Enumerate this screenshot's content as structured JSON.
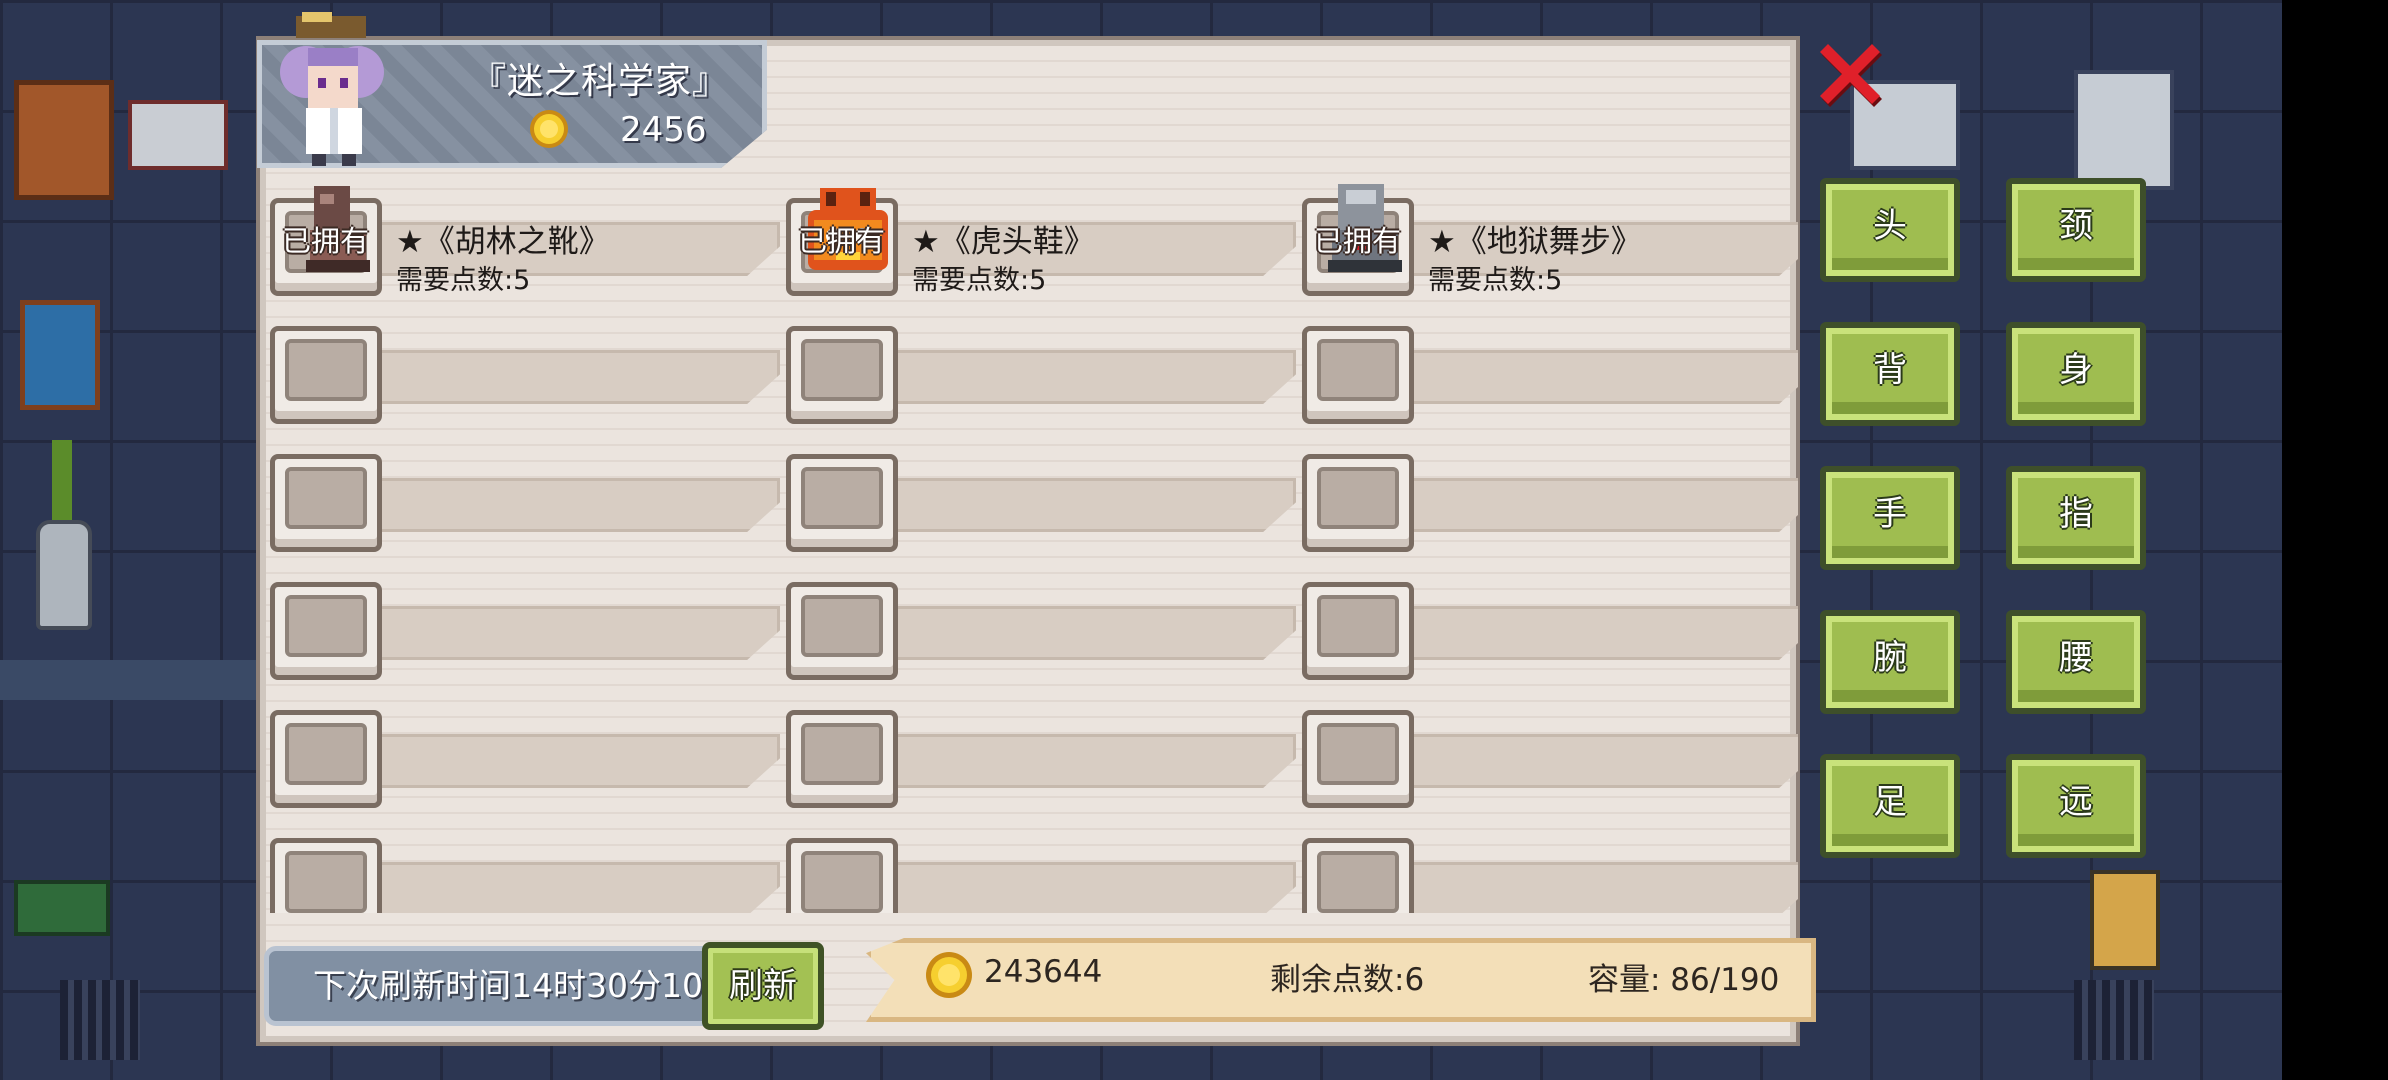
{
  "merchant": {
    "name": "『迷之科学家』",
    "gold": "2456"
  },
  "items": [
    [
      {
        "owned_label": "已拥有",
        "name": "★《胡林之靴》",
        "cost": "需要点数:5",
        "icon": "hurin-boots-icon"
      },
      {
        "owned_label": "已拥有",
        "name": "★《虎头鞋》",
        "cost": "需要点数:5",
        "icon": "tiger-shoes-icon"
      },
      {
        "owned_label": "已拥有",
        "name": "★《地狱舞步》",
        "cost": "需要点数:5",
        "icon": "hell-dance-icon"
      }
    ],
    [
      {
        "empty": true
      },
      {
        "empty": true
      },
      {
        "empty": true
      }
    ],
    [
      {
        "empty": true
      },
      {
        "empty": true
      },
      {
        "empty": true
      }
    ],
    [
      {
        "empty": true
      },
      {
        "empty": true
      },
      {
        "empty": true
      }
    ],
    [
      {
        "empty": true
      },
      {
        "empty": true
      },
      {
        "empty": true
      }
    ],
    [
      {
        "empty": true
      },
      {
        "empty": true
      },
      {
        "empty": true
      }
    ]
  ],
  "footer": {
    "refresh_timer": "下次刷新时间14时30分10",
    "refresh_button": "刷新",
    "gold": "243644",
    "points": "剩余点数:6",
    "capacity": "容量:  86/190"
  },
  "categories": [
    "头",
    "颈",
    "背",
    "身",
    "手",
    "指",
    "腕",
    "腰",
    "足",
    "远"
  ],
  "colors": {
    "category_green": "#9fbd50",
    "panel_bg": "#e7dfd9",
    "status_bar": "#f3dfb8",
    "close_red": "#e0202a"
  }
}
